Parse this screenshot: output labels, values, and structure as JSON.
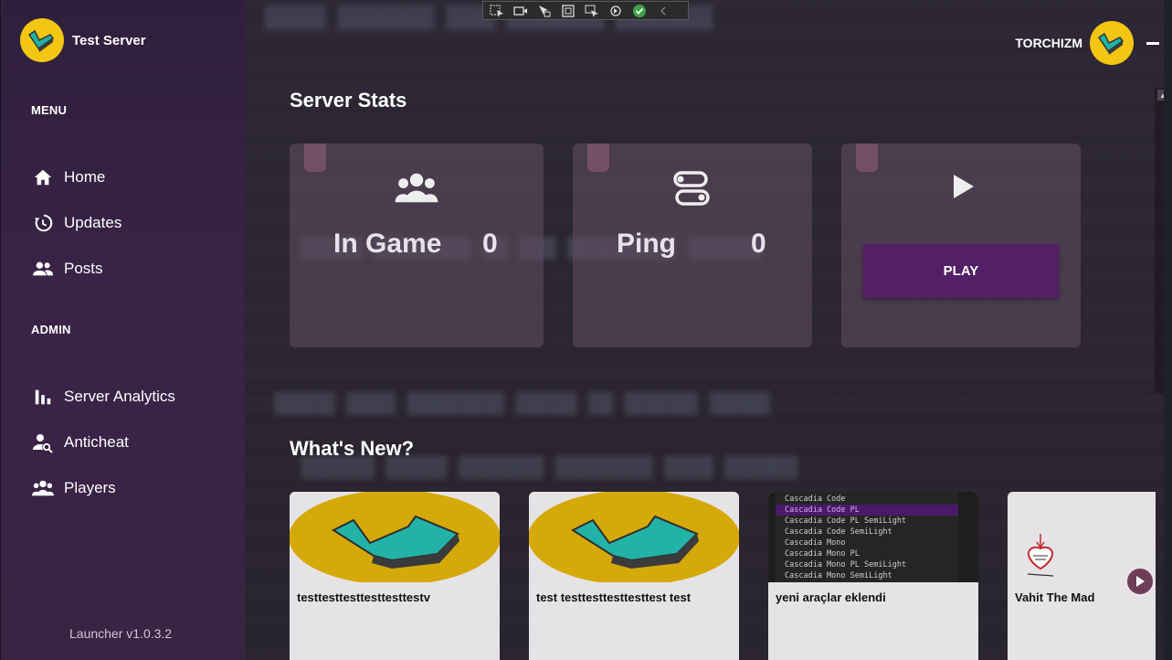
{
  "app": {
    "title": "Test Server",
    "version": "Launcher v1.0.3.2"
  },
  "user": {
    "name": "TORCHIZM"
  },
  "sidebar": {
    "menu_label": "MENU",
    "menu_items": [
      {
        "label": "Home",
        "icon": "home-icon"
      },
      {
        "label": "Updates",
        "icon": "history-icon"
      },
      {
        "label": "Posts",
        "icon": "people-icon"
      }
    ],
    "admin_label": "ADMIN",
    "admin_items": [
      {
        "label": "Server Analytics",
        "icon": "bar-chart-icon"
      },
      {
        "label": "Anticheat",
        "icon": "person-search-icon"
      },
      {
        "label": "Players",
        "icon": "group-icon"
      }
    ]
  },
  "stats": {
    "title": "Server Stats",
    "in_game_label": "In Game",
    "in_game_value": "0",
    "ping_label": "Ping",
    "ping_value": "0",
    "play_label": "PLAY"
  },
  "news": {
    "title": "What's New?",
    "items": [
      {
        "title": "testtesttesttesttesttestv",
        "image": "logo"
      },
      {
        "title": "test testtesttesttesttest test",
        "image": "logo"
      },
      {
        "title": "yeni araçlar eklendi",
        "image": "font-list",
        "font_list": [
          "Cascadia Code",
          "Cascadia Code PL",
          "Cascadia Code PL SemiLight",
          "Cascadia Code SemiLight",
          "Cascadia Mono",
          "Cascadia Mono PL",
          "Cascadia Mono PL SemiLight",
          "Cascadia Mono SemiLight"
        ]
      },
      {
        "title": "Vahit The Mad",
        "image": "heart-sketch"
      }
    ]
  },
  "colors": {
    "sidebar": "#3a2347",
    "accent": "#531f66",
    "logo_yellow": "#f3c614",
    "logo_teal": "#1fb3a8"
  }
}
